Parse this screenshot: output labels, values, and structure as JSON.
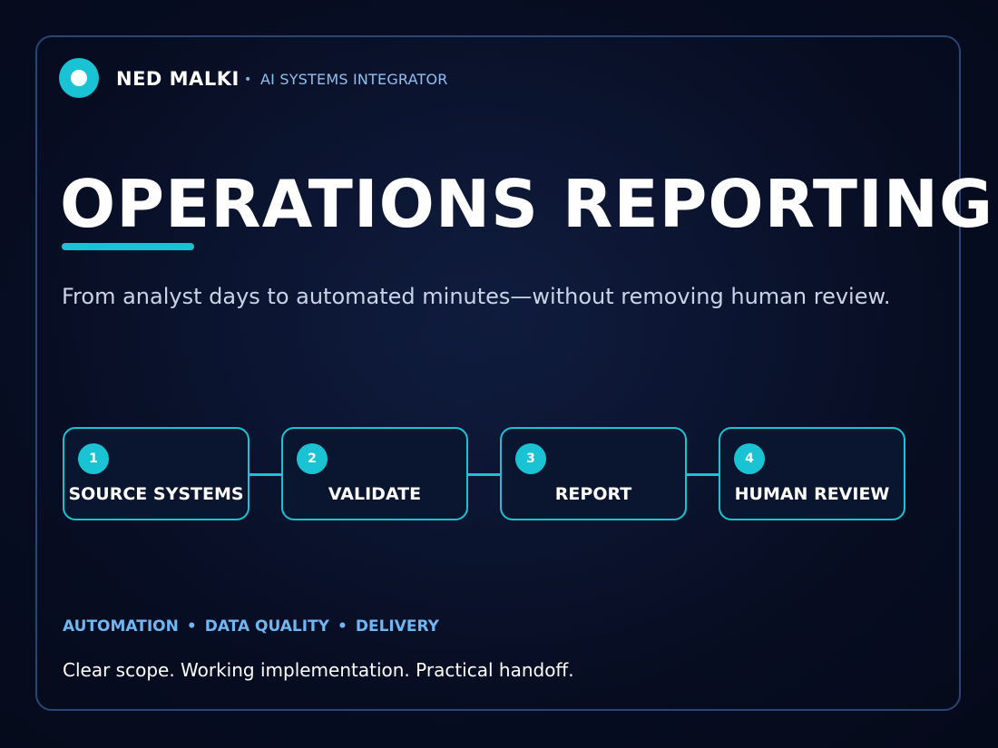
{
  "brand": {
    "name": "NED MALKI",
    "separator": "•",
    "role": "AI SYSTEMS INTEGRATOR"
  },
  "headline": {
    "title": "OPERATIONS REPORTING",
    "subtitle": "From analyst days to automated minutes—without removing human review."
  },
  "pipeline": {
    "steps": [
      {
        "number": "1",
        "label": "SOURCE SYSTEMS"
      },
      {
        "number": "2",
        "label": "VALIDATE"
      },
      {
        "number": "3",
        "label": "REPORT"
      },
      {
        "number": "4",
        "label": "HUMAN REVIEW"
      }
    ]
  },
  "footer": {
    "tags": [
      "AUTOMATION",
      "DATA QUALITY",
      "DELIVERY"
    ],
    "tag_separator": "•",
    "tagline": "Clear scope. Working implementation. Practical handoff."
  },
  "colors": {
    "accent": "#19c3d3",
    "background": "#070d22",
    "tag_text": "#6fb6f2"
  },
  "icons": {
    "logo": "circle-dot-logo-icon"
  }
}
